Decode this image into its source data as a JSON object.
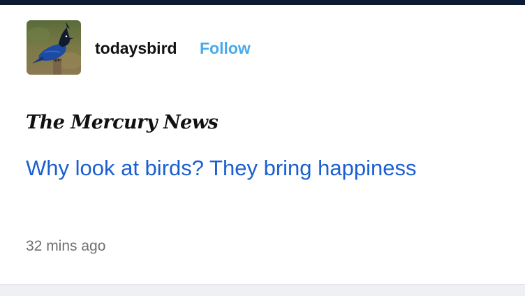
{
  "post": {
    "username": "todaysbird",
    "follow_label": "Follow",
    "publisher": "The Mercury News",
    "headline": "Why look at birds? They bring happiness",
    "timestamp": "32 mins ago"
  },
  "colors": {
    "follow": "#4aa9ec",
    "headline_link": "#1a5fd1",
    "top_bar": "#0a1b33"
  },
  "icons": {
    "avatar": "steller-jay-avatar"
  }
}
